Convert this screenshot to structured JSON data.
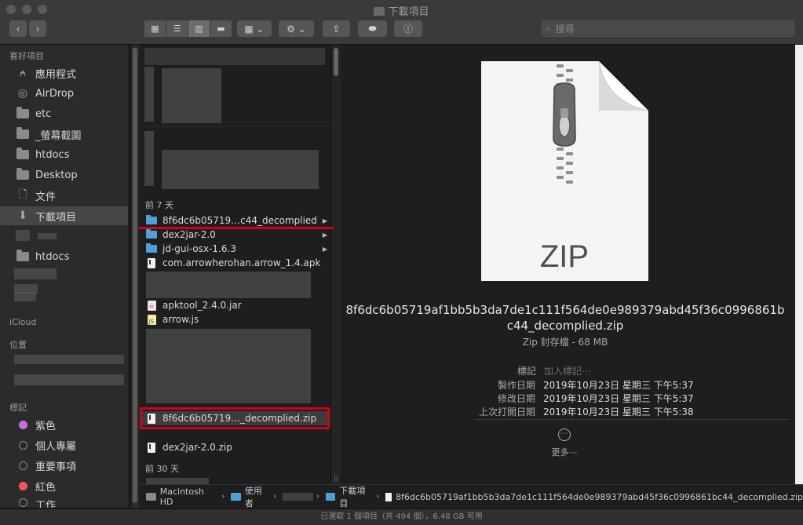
{
  "window": {
    "title": "下載項目"
  },
  "toolbar": {
    "search_placeholder": "搜尋"
  },
  "sidebar": {
    "favorites_header": "喜好項目",
    "favorites": [
      {
        "label": "應用程式",
        "icon": "applications-icon"
      },
      {
        "label": "AirDrop",
        "icon": "airdrop-icon"
      },
      {
        "label": "etc",
        "icon": "folder-icon"
      },
      {
        "label": "_螢幕截圖",
        "icon": "folder-icon"
      },
      {
        "label": "htdocs",
        "icon": "folder-icon"
      },
      {
        "label": "Desktop",
        "icon": "folder-icon"
      },
      {
        "label": "文件",
        "icon": "document-icon"
      },
      {
        "label": "下載項目",
        "icon": "download-icon"
      },
      {
        "label": "htdocs",
        "icon": "folder-icon"
      }
    ],
    "icloud_header": "iCloud",
    "locations_header": "位置",
    "tags_header": "標記",
    "tags": [
      {
        "label": "紫色",
        "color": "#c36fe0"
      },
      {
        "label": "個人專屬",
        "color": "#3a3a3a"
      },
      {
        "label": "重要事項",
        "color": "#3a3a3a"
      },
      {
        "label": "紅色",
        "color": "#f0555b"
      },
      {
        "label": "工作",
        "color": "#3a3a3a"
      }
    ]
  },
  "files": {
    "group_7days": "前 7 天",
    "group_30days": "前 30 天",
    "items": [
      {
        "name": "8f6dc6b05719…c44_decomplied",
        "type": "folder",
        "arrow": "▶"
      },
      {
        "name": "dex2jar-2.0",
        "type": "folder",
        "arrow": "▶"
      },
      {
        "name": "jd-gui-osx-1.6.3",
        "type": "folder",
        "arrow": "▶"
      },
      {
        "name": "com.arrowherohan.arrow_1.4.apk",
        "type": "doc"
      },
      {
        "name": "apktool_2.4.0.jar",
        "type": "jar"
      },
      {
        "name": "arrow.js",
        "type": "js"
      },
      {
        "name": "8f6dc6b05719…_decomplied.zip",
        "type": "zip"
      },
      {
        "name": "dex2jar-2.0.zip",
        "type": "zip"
      }
    ]
  },
  "preview": {
    "zip_label": "ZIP",
    "filename": "8f6dc6b05719af1bb5b3da7de1c111f564de0e989379abd45f36c0996861bc44_decomplied.zip",
    "filename_line1": "8f6dc6b05719af1bb5b3da7de1c111f564de0e989379abd45f36c0996861b",
    "filename_line2": "c44_decomplied.zip",
    "kind": "Zip 封存檔 - 68 MB",
    "tags_label": "標記",
    "tags_placeholder": "加入標記⋯",
    "created_label": "製作日期",
    "created_value": "2019年10月23日 星期三 下午5:37",
    "modified_label": "修改日期",
    "modified_value": "2019年10月23日 星期三 下午5:37",
    "opened_label": "上次打開日期",
    "opened_value": "2019年10月23日 星期三 下午5:38",
    "more_label": "更多⋯"
  },
  "pathbar": {
    "items": [
      "Macintosh HD",
      "使用者",
      "下載項目",
      "8f6dc6b05719af1bb5b3da7de1c111f564de0e989379abd45f36c0996861bc44_decomplied.zip"
    ]
  },
  "status": {
    "text": "已選取 1 個項目（共 494 個），6.48 GB 可用"
  }
}
